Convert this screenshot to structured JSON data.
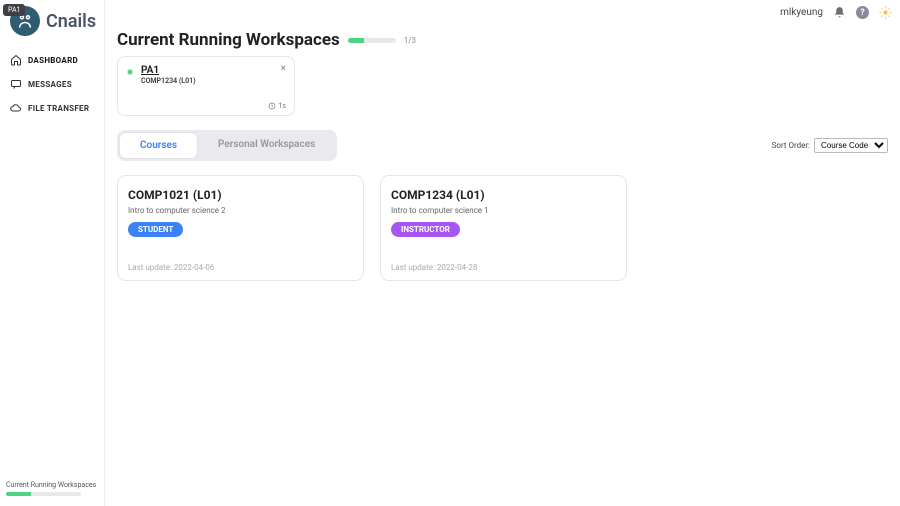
{
  "brand": "Cnails",
  "tooltip": "PA1",
  "nav": [
    {
      "label": "DASHBOARD",
      "icon": "home"
    },
    {
      "label": "MESSAGES",
      "icon": "chat"
    },
    {
      "label": "FILE TRANSFER",
      "icon": "cloud"
    }
  ],
  "sidebar_footer": {
    "title": "Current Running Workspaces"
  },
  "user": {
    "name": "mlkyeung"
  },
  "section": {
    "title": "Current Running Workspaces",
    "usage": "1/3"
  },
  "workspace": {
    "name": "PA1",
    "course": "COMP1234 (L01)",
    "time": "1s"
  },
  "tabs": {
    "courses": "Courses",
    "personal": "Personal Workspaces"
  },
  "sort": {
    "label": "Sort Order:",
    "options": [
      "Course Code"
    ]
  },
  "courses": [
    {
      "title": "COMP1021 (L01)",
      "subtitle": "Intro to computer science 2",
      "role": "STUDENT",
      "updated": "Last update: 2022-04-06"
    },
    {
      "title": "COMP1234 (L01)",
      "subtitle": "Intro to computer science 1",
      "role": "INSTRUCTOR",
      "updated": "Last update: 2022-04-28"
    }
  ]
}
